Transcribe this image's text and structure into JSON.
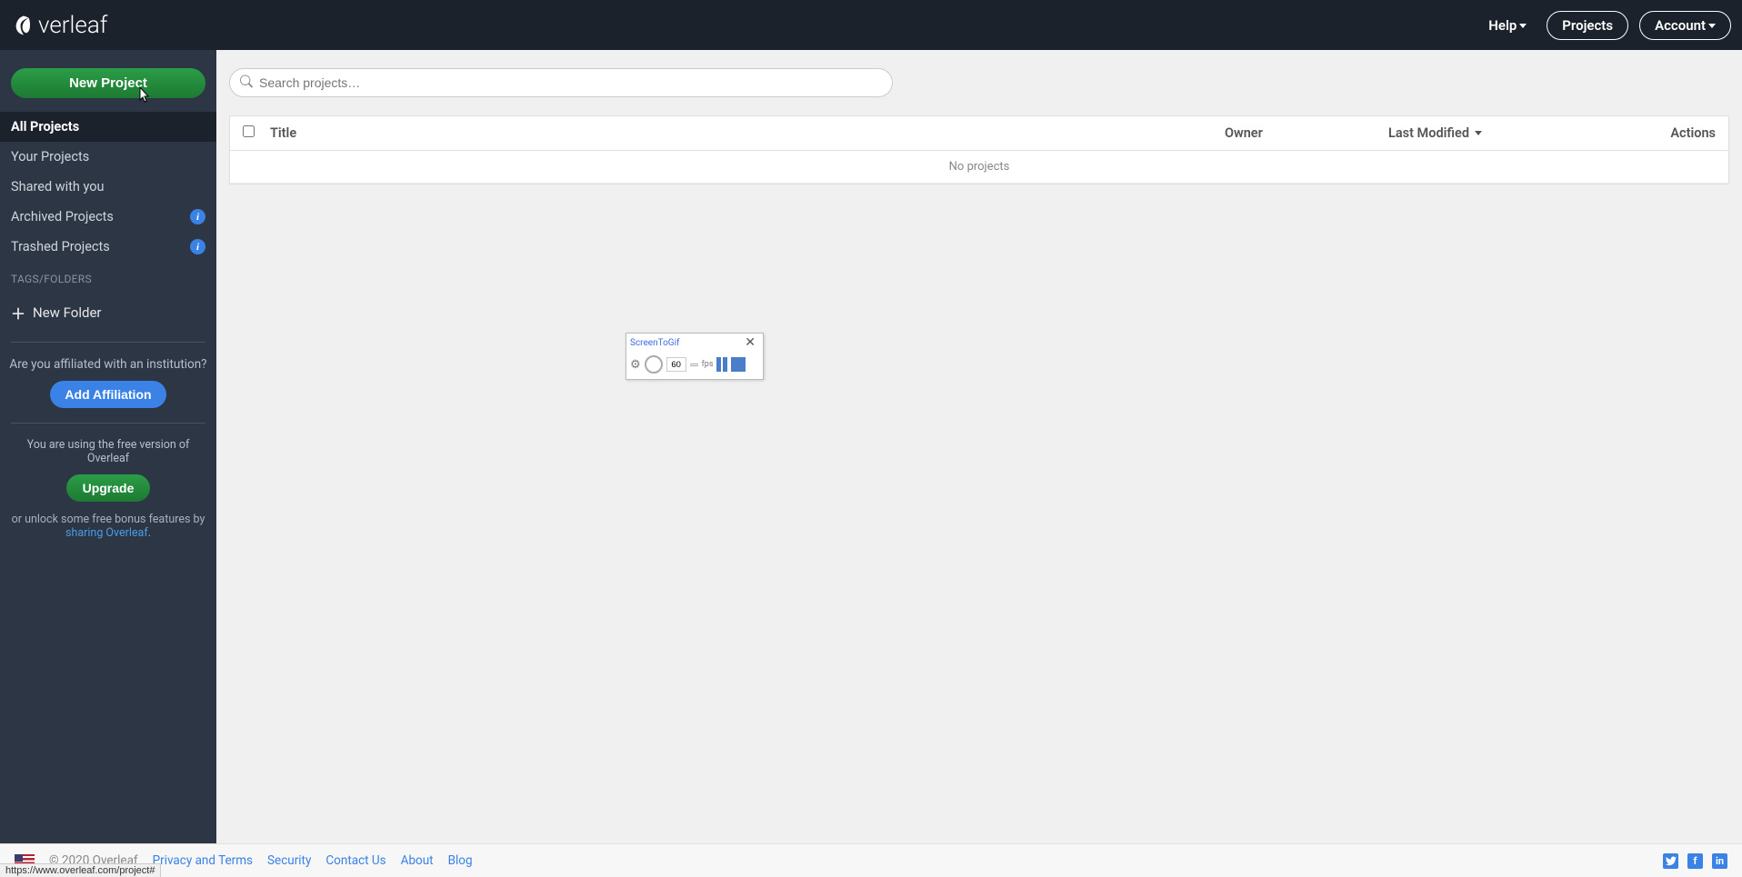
{
  "header": {
    "logo_text": "verleaf",
    "help": "Help",
    "projects": "Projects",
    "account": "Account"
  },
  "sidebar": {
    "new_project": "New Project",
    "items": [
      {
        "label": "All Projects",
        "active": true,
        "info": false
      },
      {
        "label": "Your Projects",
        "active": false,
        "info": false
      },
      {
        "label": "Shared with you",
        "active": false,
        "info": false
      },
      {
        "label": "Archived Projects",
        "active": false,
        "info": true
      },
      {
        "label": "Trashed Projects",
        "active": false,
        "info": true
      }
    ],
    "tags_label": "TAGS/FOLDERS",
    "new_folder": "New Folder",
    "affiliation_q": "Are you affiliated with an institution?",
    "add_affiliation": "Add Affiliation",
    "free_version": "You are using the free version of Overleaf",
    "upgrade": "Upgrade",
    "unlock_prefix": "or unlock some free bonus features by ",
    "sharing_link": "sharing Overleaf"
  },
  "search": {
    "placeholder": "Search projects…"
  },
  "table": {
    "title": "Title",
    "owner": "Owner",
    "modified": "Last Modified",
    "actions": "Actions",
    "no_projects": "No projects"
  },
  "footer": {
    "copyright": "© 2020 Overleaf",
    "links": [
      "Privacy and Terms",
      "Security",
      "Contact Us",
      "About",
      "Blog"
    ]
  },
  "status_url": "https://www.overleaf.com/project#",
  "screen_to_gif": {
    "title": "ScreenToGif",
    "fps": "60",
    "fps_label": "fps"
  }
}
